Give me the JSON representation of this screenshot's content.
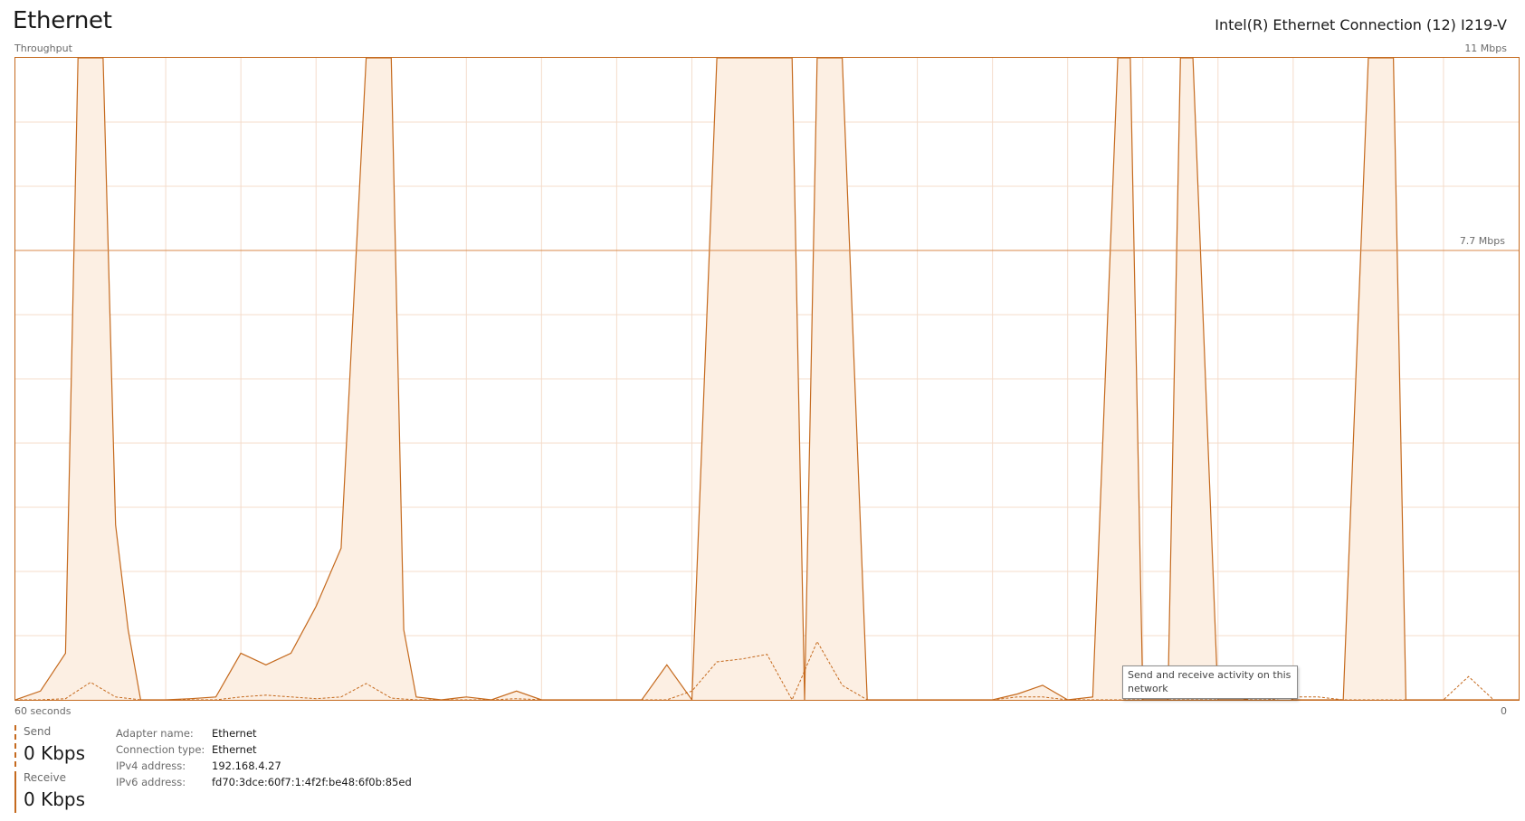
{
  "header": {
    "title": "Ethernet",
    "adapter_name": "Intel(R) Ethernet Connection (12) I219-V"
  },
  "graph": {
    "label": "Throughput",
    "max_label": "11 Mbps",
    "mid_label": "7.7 Mbps",
    "time_label": "60 seconds",
    "zero_label": "0",
    "tooltip": "Send and receive activity on this network"
  },
  "chart_data": {
    "type": "area",
    "x_range_seconds": [
      0,
      60
    ],
    "y_range_mbps": [
      0,
      11
    ],
    "reference_line_mbps": 7.7,
    "grid": true,
    "series": [
      {
        "style": "solid",
        "x": [
          0,
          1,
          2,
          2.5,
          3.5,
          4,
          4.5,
          5,
          6,
          7,
          8,
          9,
          10,
          11,
          12,
          13,
          14,
          15,
          15.5,
          16,
          17,
          18,
          19,
          20,
          21,
          22,
          23,
          24,
          25,
          26,
          27,
          28,
          28.5,
          29,
          30,
          31,
          31.5,
          32,
          33,
          34,
          35,
          35.5,
          36,
          37,
          38,
          39,
          40,
          41,
          42,
          43,
          44,
          44.5,
          45,
          46,
          46.5,
          47,
          48,
          49,
          49.5,
          50,
          51,
          52,
          53,
          54,
          55,
          55.5,
          56,
          57,
          58,
          59,
          60
        ],
        "y": [
          0,
          0.15,
          0.8,
          11,
          11,
          3,
          1.2,
          0,
          0,
          0.02,
          0.05,
          0.8,
          0.6,
          0.8,
          1.6,
          2.6,
          11,
          11,
          1.2,
          0.05,
          0,
          0.05,
          0,
          0.15,
          0,
          0,
          0,
          0,
          0,
          0.6,
          0,
          11,
          11,
          11,
          11,
          11,
          0,
          11,
          11,
          0,
          0,
          0,
          0,
          0,
          0,
          0,
          0.1,
          0.25,
          0,
          0.05,
          11,
          11,
          0,
          0,
          11,
          11,
          0,
          0,
          0.05,
          0.25,
          0,
          0,
          0,
          11,
          11,
          0,
          0,
          0,
          0,
          0,
          0
        ]
      },
      {
        "style": "dashed",
        "x": [
          0,
          1,
          2,
          3,
          4,
          5,
          6,
          7,
          8,
          9,
          10,
          11,
          12,
          13,
          14,
          15,
          16,
          17,
          18,
          19,
          20,
          21,
          22,
          23,
          24,
          25,
          26,
          27,
          28,
          29,
          30,
          31,
          32,
          33,
          34,
          35,
          36,
          37,
          38,
          39,
          40,
          41,
          42,
          43,
          44,
          45,
          46,
          47,
          48,
          49,
          50,
          51,
          52,
          53,
          54,
          55,
          56,
          57,
          58,
          59,
          60
        ],
        "y": [
          0,
          0,
          0.02,
          0.3,
          0.05,
          0,
          0,
          0,
          0,
          0.05,
          0.08,
          0.05,
          0.02,
          0.05,
          0.28,
          0.03,
          0,
          0,
          0,
          0,
          0.02,
          0,
          0,
          0,
          0,
          0,
          0,
          0.15,
          0.65,
          0.7,
          0.78,
          0,
          1.0,
          0.25,
          0,
          0,
          0,
          0,
          0,
          0,
          0.05,
          0.05,
          0,
          0,
          0,
          0,
          0,
          0,
          0,
          0,
          0,
          0.05,
          0.05,
          0,
          0,
          0,
          0,
          0,
          0.4,
          0,
          0
        ]
      }
    ]
  },
  "stats": {
    "send_label": "Send",
    "send_value": "0 Kbps",
    "receive_label": "Receive",
    "receive_value": "0 Kbps"
  },
  "properties": [
    {
      "key": "Adapter name:",
      "value": "Ethernet"
    },
    {
      "key": "Connection type:",
      "value": "Ethernet"
    },
    {
      "key": "IPv4 address:",
      "value": "192.168.4.27"
    },
    {
      "key": "IPv6 address:",
      "value": "fd70:3dce:60f7:1:4f2f:be48:6f0b:85ed"
    }
  ],
  "colors": {
    "line": "#c56a1e",
    "fill": "#fcefe3",
    "grid": "#f4dccb",
    "reference_line": "#d98a4b"
  }
}
